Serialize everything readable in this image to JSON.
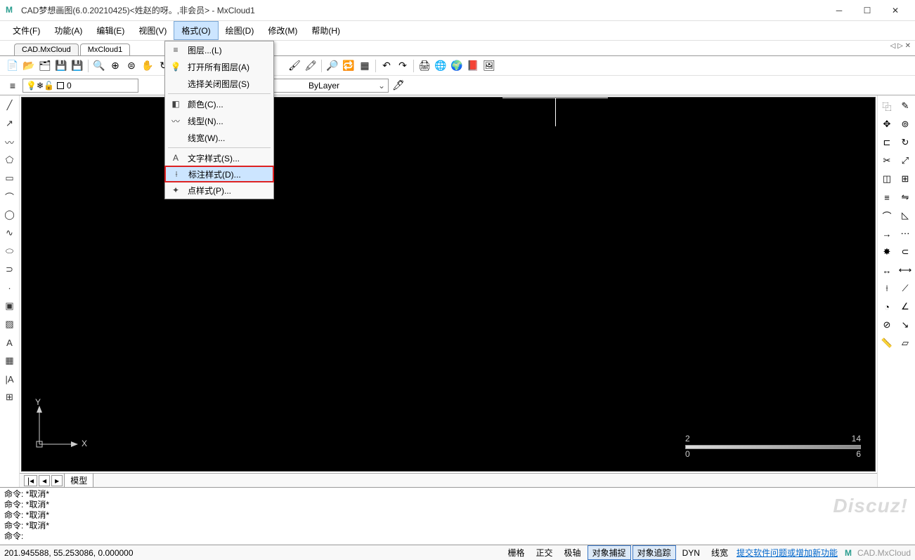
{
  "title": "CAD梦想画图(6.0.20210425)<姓赵的呀。,非会员> - MxCloud1",
  "menu": {
    "items": [
      {
        "label": "文件(F)"
      },
      {
        "label": "功能(A)"
      },
      {
        "label": "编辑(E)"
      },
      {
        "label": "视图(V)"
      },
      {
        "label": "格式(O)",
        "active": true
      },
      {
        "label": "绘图(D)"
      },
      {
        "label": "修改(M)"
      },
      {
        "label": "帮助(H)"
      }
    ]
  },
  "dropdown": {
    "items": [
      {
        "icon": "layers",
        "label": "图层...(L)"
      },
      {
        "icon": "bulb",
        "label": "打开所有图层(A)"
      },
      {
        "icon": "",
        "label": "选择关闭图层(S)"
      },
      {
        "sep": true
      },
      {
        "icon": "palette",
        "label": "颜色(C)..."
      },
      {
        "icon": "line",
        "label": "线型(N)..."
      },
      {
        "icon": "",
        "label": "线宽(W)..."
      },
      {
        "sep": true
      },
      {
        "icon": "text",
        "label": "文字样式(S)..."
      },
      {
        "icon": "dim",
        "label": "标注样式(D)...",
        "highlight": true
      },
      {
        "icon": "point",
        "label": "点样式(P)..."
      }
    ]
  },
  "tabs": {
    "items": [
      {
        "label": "CAD.MxCloud"
      },
      {
        "label": "MxCloud1",
        "active": true
      }
    ]
  },
  "layer": {
    "current": "0"
  },
  "linetype": {
    "current": "ByLayer"
  },
  "bottomtab": {
    "model": "模型"
  },
  "cmd": {
    "lines": [
      "命令:   *取消*",
      "命令:   *取消*",
      "命令:   *取消*",
      "命令:   *取消*",
      "命令:"
    ]
  },
  "status": {
    "coords": "201.945588,  55.253086,  0.000000",
    "btns": [
      {
        "label": "栅格"
      },
      {
        "label": "正交"
      },
      {
        "label": "极轴"
      },
      {
        "label": "对象捕捉",
        "active": true
      },
      {
        "label": "对象追踪",
        "active": true
      },
      {
        "label": "DYN"
      },
      {
        "label": "线宽"
      }
    ],
    "link": "提交软件问题或增加新功能",
    "brand": "CAD.MxCloud"
  },
  "scale": {
    "t0": "2",
    "t1": "14",
    "b0": "0",
    "b1": "6"
  },
  "watermark": "Discuz!"
}
